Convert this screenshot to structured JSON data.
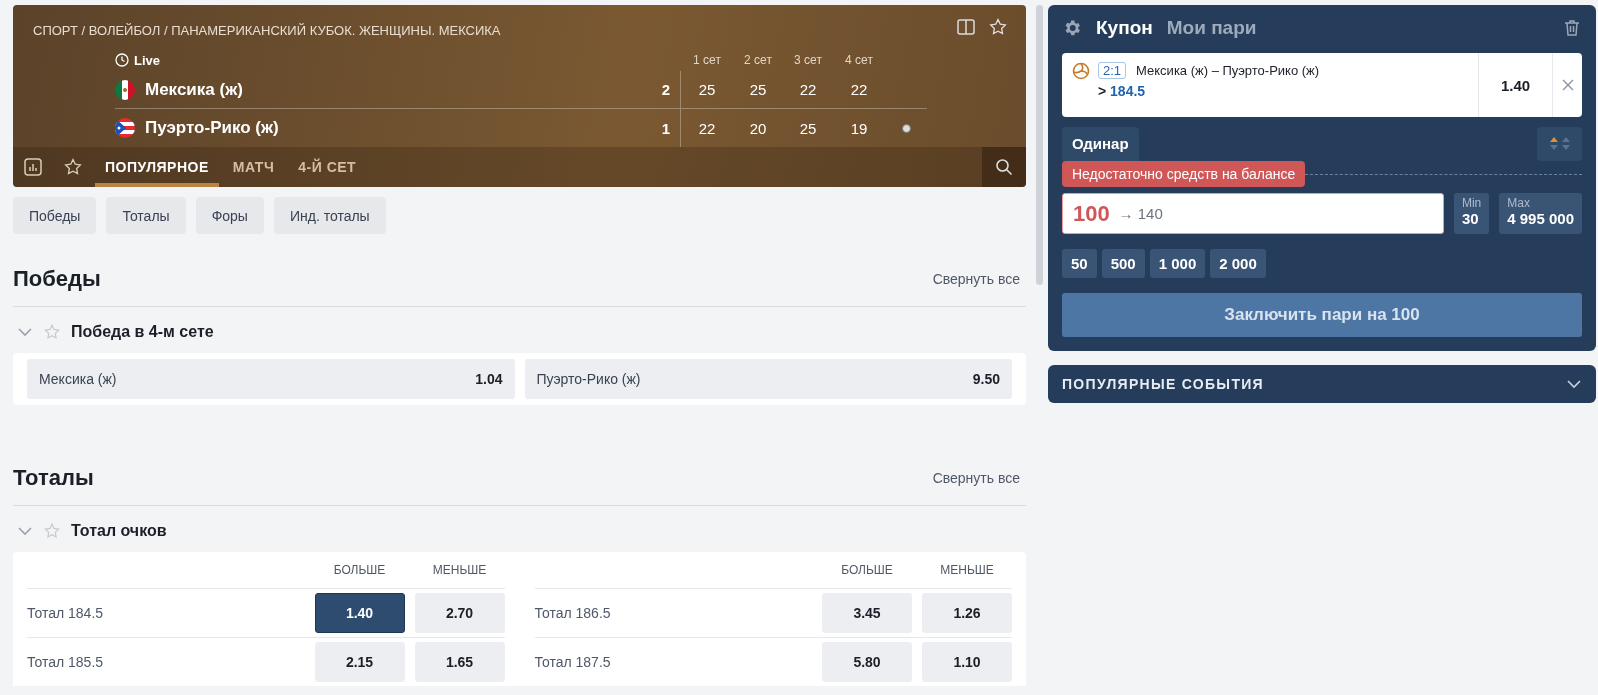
{
  "event": {
    "breadcrumb": "СПОРТ / ВОЛЕЙБОЛ / ПАНАМЕРИКАНСКИЙ КУБОК. ЖЕНЩИНЫ. МЕКСИКА",
    "live": "Live",
    "set_headers": [
      "1 сет",
      "2 сет",
      "3 сет",
      "4 сет"
    ],
    "teams": [
      {
        "name": "Мексика (ж)",
        "score": "2",
        "sets": [
          "25",
          "25",
          "22",
          "22"
        ],
        "serving": false
      },
      {
        "name": "Пуэрто-Рико (ж)",
        "score": "1",
        "sets": [
          "22",
          "20",
          "25",
          "19"
        ],
        "serving": true
      }
    ],
    "tabs": [
      {
        "label": "ПОПУЛЯРНОЕ",
        "selected": true
      },
      {
        "label": "МАТЧ",
        "selected": false
      },
      {
        "label": "4-Й СЕТ",
        "selected": false
      }
    ]
  },
  "filters": [
    "Победы",
    "Тоталы",
    "Форы",
    "Инд. тоталы"
  ],
  "sections": [
    {
      "title": "Победы",
      "collapse": "Свернуть все",
      "markets": [
        {
          "title": "Победа в 4-м сете",
          "kind": "two-way",
          "outcomes": [
            {
              "label": "Мексика (ж)",
              "odds": "1.04",
              "selected": false
            },
            {
              "label": "Пуэрто-Рико (ж)",
              "odds": "9.50",
              "selected": false
            }
          ]
        }
      ]
    },
    {
      "title": "Тоталы",
      "collapse": "Свернуть все",
      "markets": [
        {
          "title": "Тотал очков",
          "kind": "table",
          "columns": [
            "БОЛЬШЕ",
            "МЕНЬШЕ",
            "БОЛЬШЕ",
            "МЕНЬШЕ"
          ],
          "rows": [
            {
              "label": "Тотал 184.5",
              "odds": [
                {
                  "value": "1.40",
                  "selected": true
                },
                {
                  "value": "2.70",
                  "selected": false
                }
              ]
            },
            {
              "label": "Тотал 186.5",
              "odds": [
                {
                  "value": "3.45",
                  "selected": false
                },
                {
                  "value": "1.26",
                  "selected": false
                }
              ]
            },
            {
              "label": "Тотал 185.5",
              "odds": [
                {
                  "value": "2.15",
                  "selected": false
                },
                {
                  "value": "1.65",
                  "selected": false
                }
              ]
            },
            {
              "label": "Тотал 187.5",
              "odds": [
                {
                  "value": "5.80",
                  "selected": false
                },
                {
                  "value": "1.10",
                  "selected": false
                }
              ]
            }
          ]
        }
      ]
    }
  ],
  "coupon": {
    "tabs": [
      {
        "label": "Купон",
        "selected": true
      },
      {
        "label": "Мои пари",
        "selected": false
      }
    ],
    "bet": {
      "score": "2:1",
      "match": "Мексика (ж) – Пуэрто-Рико (ж)",
      "pick_prefix": ">",
      "pick": "184.5",
      "odds": "1.40"
    },
    "type": "Одинар",
    "error": "Недостаточно средств на балансе",
    "stake": "100",
    "payout": "→ 140",
    "min": {
      "label": "Min",
      "value": "30"
    },
    "max": {
      "label": "Max",
      "value": "4 995 000"
    },
    "quick_amounts": [
      "50",
      "500",
      "1 000",
      "2 000"
    ],
    "submit": "Заключить пари на 100"
  },
  "popular": {
    "title": "ПОПУЛЯРНЫЕ СОБЫТИЯ",
    "expanded": false
  }
}
